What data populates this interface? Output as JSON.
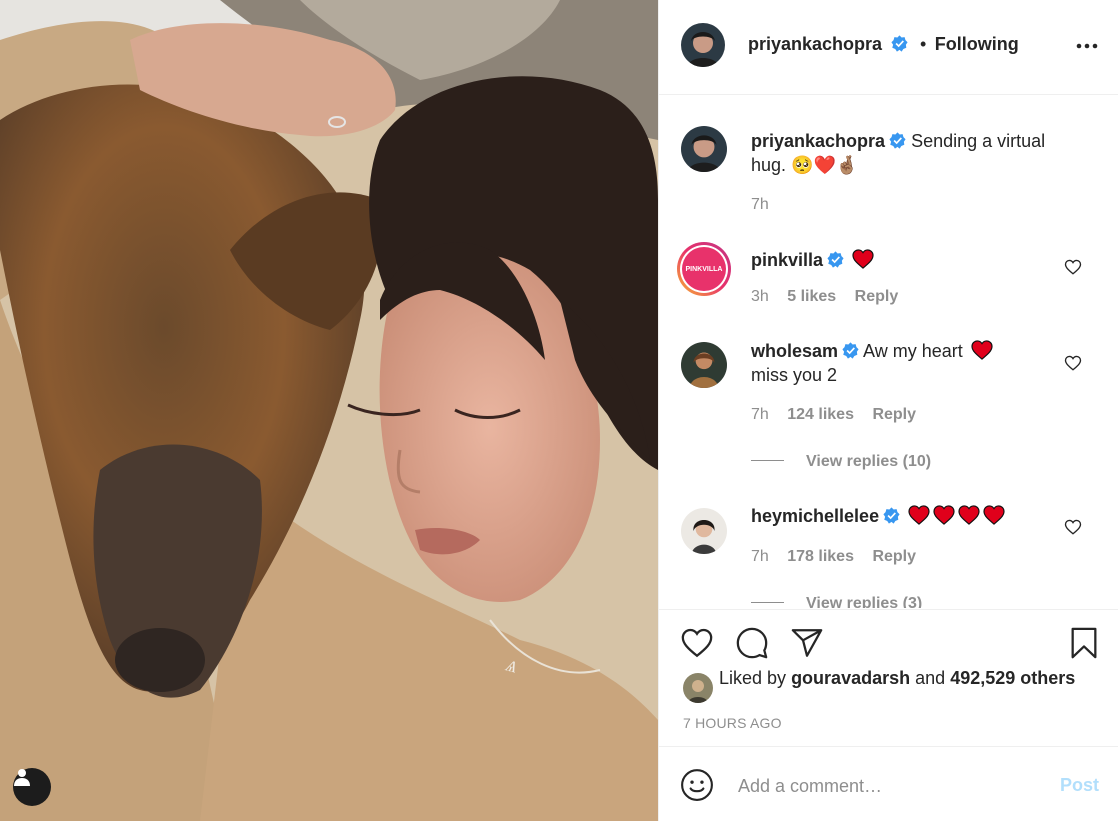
{
  "post": {
    "author": "priyankachopra",
    "follow_separator": "•",
    "follow_status": "Following",
    "more_icon": "more-options-icon",
    "caption_text": "Sending a virtual hug.",
    "caption_emoji": "🥺❤️🤞🏽",
    "caption_time": "7h"
  },
  "comments": [
    {
      "username": "pinkvilla",
      "avatar_text": "PINKVILLA",
      "text": "",
      "hearts": 1,
      "time": "3h",
      "likes": "5 likes",
      "reply": "Reply"
    },
    {
      "username": "wholesam",
      "text": "Aw my heart",
      "text2": "miss you 2",
      "hearts": 1,
      "time": "7h",
      "likes": "124 likes",
      "reply": "Reply",
      "view_replies": "View replies (10)"
    },
    {
      "username": "heymichellelee",
      "text": "",
      "hearts": 4,
      "time": "7h",
      "likes": "178 likes",
      "reply": "Reply",
      "view_replies": "View replies (3)"
    }
  ],
  "likes": {
    "prefix": "Liked by",
    "first_user": "gouravadarsh",
    "and": "and",
    "others": "492,529 others"
  },
  "timestamp": "7 HOURS AGO",
  "add_comment": {
    "placeholder": "Add a comment…",
    "post_label": "Post"
  },
  "colors": {
    "verified": "#3897f0",
    "heart_red": "#e0001b",
    "post_button_disabled": "#b2dffc",
    "text_secondary": "#8e8e8e",
    "pinkvilla_brand": "#e8326b"
  },
  "icons": [
    "like-icon",
    "comment-icon",
    "share-icon",
    "save-icon",
    "emoji-icon",
    "user-tag-icon"
  ]
}
